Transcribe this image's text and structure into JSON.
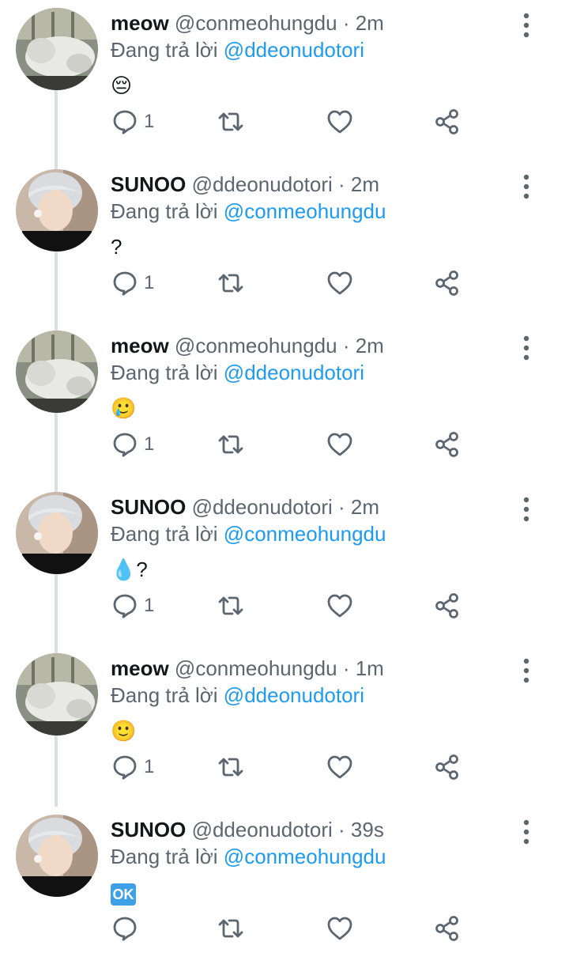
{
  "colors": {
    "mention": "#1d9bf0",
    "muted": "#5b6670",
    "thread_line": "#dcdfe2"
  },
  "reply_prefix": "Đang trả lời",
  "tweets": [
    {
      "name": "meow",
      "handle": "@conmeohungdu",
      "time": "· 2m",
      "mention": "@ddeonudotori",
      "text": "😔",
      "reply_count": "1",
      "avatar": "cat-avatar"
    },
    {
      "name": "SUNOO",
      "handle": "@ddeonudotori",
      "time": "· 2m",
      "mention": "@conmeohungdu",
      "text": "?",
      "reply_count": "1",
      "avatar": "person-avatar"
    },
    {
      "name": "meow",
      "handle": "@conmeohungdu",
      "time": "· 2m",
      "mention": "@ddeonudotori",
      "text": "🥲",
      "reply_count": "1",
      "avatar": "cat-avatar"
    },
    {
      "name": "SUNOO",
      "handle": "@ddeonudotori",
      "time": "· 2m",
      "mention": "@conmeohungdu",
      "text": "💧?",
      "reply_count": "1",
      "avatar": "person-avatar"
    },
    {
      "name": "meow",
      "handle": "@conmeohungdu",
      "time": "· 1m",
      "mention": "@ddeonudotori",
      "text": "🙂",
      "reply_count": "1",
      "avatar": "cat-avatar"
    },
    {
      "name": "SUNOO",
      "handle": "@ddeonudotori",
      "time": "· 39s",
      "mention": "@conmeohungdu",
      "text": "OK",
      "reply_count": "",
      "avatar": "person-avatar"
    }
  ],
  "icons": {
    "reply": "reply-icon",
    "retweet": "retweet-icon",
    "like": "heart-icon",
    "share": "share-icon",
    "more": "more-vertical-icon"
  }
}
